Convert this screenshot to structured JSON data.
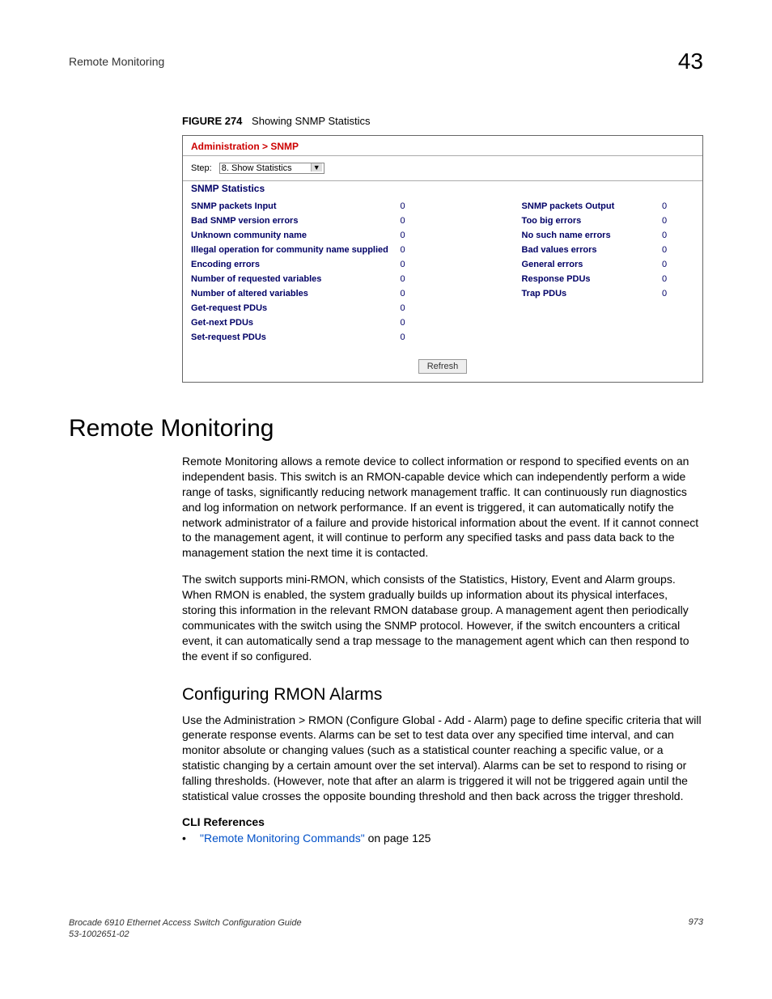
{
  "header": {
    "section": "Remote Monitoring",
    "chapter": "43"
  },
  "figure": {
    "label": "FIGURE 274",
    "caption": "Showing SNMP Statistics",
    "breadcrumb": "Administration > SNMP",
    "step_label": "Step:",
    "step_value": "8. Show Statistics",
    "subtitle": "SNMP Statistics",
    "left_stats": [
      {
        "label": "SNMP packets Input",
        "value": "0"
      },
      {
        "label": "Bad SNMP version errors",
        "value": "0"
      },
      {
        "label": "Unknown community name",
        "value": "0"
      },
      {
        "label": "Illegal operation for community name supplied",
        "value": "0"
      },
      {
        "label": "Encoding errors",
        "value": "0"
      },
      {
        "label": "Number of requested variables",
        "value": "0"
      },
      {
        "label": "Number of altered variables",
        "value": "0"
      },
      {
        "label": "Get-request PDUs",
        "value": "0"
      },
      {
        "label": "Get-next PDUs",
        "value": "0"
      },
      {
        "label": "Set-request PDUs",
        "value": "0"
      }
    ],
    "right_stats": [
      {
        "label": "SNMP packets Output",
        "value": "0"
      },
      {
        "label": "Too big errors",
        "value": "0"
      },
      {
        "label": "No such name errors",
        "value": "0"
      },
      {
        "label": "Bad values errors",
        "value": "0"
      },
      {
        "label": "General errors",
        "value": "0"
      },
      {
        "label": "Response PDUs",
        "value": "0"
      },
      {
        "label": "Trap PDUs",
        "value": "0"
      }
    ],
    "refresh": "Refresh"
  },
  "section": {
    "title": "Remote Monitoring",
    "p1": "Remote Monitoring allows a remote device to collect information or respond to specified events on an independent basis. This switch is an RMON-capable device which can independently perform a wide range of tasks, significantly reducing network management traffic. It can continuously run diagnostics and log information on network performance. If an event is triggered, it can automatically notify the network administrator of a failure and provide historical information about the event. If it cannot connect to the management agent, it will continue to perform any specified tasks and pass data back to the management station the next time it is contacted.",
    "p2": "The switch supports mini-RMON, which consists of the Statistics, History, Event and Alarm groups. When RMON is enabled, the system gradually builds up information about its physical interfaces, storing this information in the relevant RMON database group. A management agent then periodically communicates with the switch using the SNMP protocol. However, if the switch encounters a critical event, it can automatically send a trap message to the management agent which can then respond to the event if so configured."
  },
  "subsection": {
    "title": "Configuring RMON Alarms",
    "p1": "Use the Administration > RMON (Configure Global - Add - Alarm) page to define specific criteria that will generate response events. Alarms can be set to test data over any specified time interval, and can monitor absolute or changing values (such as a statistical counter reaching a specific value, or a statistic changing by a certain amount over the set interval). Alarms can be set to respond to rising or falling thresholds. (However, note that after an alarm is triggered it will not be triggered again until the statistical value crosses the opposite bounding threshold and then back across the trigger threshold.",
    "cli_head": "CLI References",
    "cli_link": "\"Remote Monitoring Commands\"",
    "cli_tail": " on page 125"
  },
  "footer": {
    "line1": "Brocade 6910 Ethernet Access Switch Configuration Guide",
    "line2": "53-1002651-02",
    "pagenum": "973"
  }
}
